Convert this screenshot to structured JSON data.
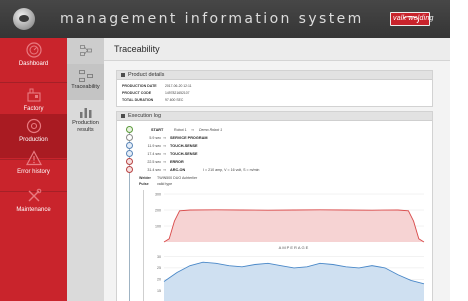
{
  "header": {
    "title": "management information system",
    "brand": "valk welding"
  },
  "sidebar": {
    "items": [
      {
        "label": "Dashboard",
        "icon": "dashboard-icon"
      },
      {
        "label": "Factory",
        "icon": "factory-icon"
      },
      {
        "label": "Production",
        "icon": "production-icon",
        "active": true
      },
      {
        "label": "Error history",
        "icon": "warning-icon"
      },
      {
        "label": "Maintenance",
        "icon": "tools-icon"
      }
    ]
  },
  "subnav": {
    "items": [
      {
        "label": "Traceability",
        "icon": "traceability-icon",
        "active": true
      },
      {
        "label": "Production results",
        "icon": "bar-chart-icon"
      }
    ]
  },
  "page": {
    "title": "Traceability"
  },
  "product_details": {
    "title": "Product details",
    "rows": [
      {
        "label": "PRODUCTION DATE",
        "value": "2017-06-20 12:11"
      },
      {
        "label": "PRODUCT CODE",
        "value": "1497821652107"
      },
      {
        "label": "TOTAL DURATION",
        "value": "97.600 SEC"
      }
    ]
  },
  "execution_log": {
    "title": "Execution log",
    "start": {
      "label": "START",
      "robot": "Robot 1",
      "arrow": "⇒",
      "description": "Demo Robot 1"
    },
    "events": [
      {
        "time": "5.9 sec",
        "arrow": "⇒",
        "event": "SERVICE PROGRAM",
        "detail": ""
      },
      {
        "time": "11.9 sec",
        "arrow": "⇒",
        "event": "TOUCH-SENSE",
        "detail": ""
      },
      {
        "time": "17.4 sec",
        "arrow": "⇒",
        "event": "TOUCH-SENSE",
        "detail": ""
      },
      {
        "time": "22.5 sec",
        "arrow": "⇒",
        "event": "ERROR",
        "detail": ""
      },
      {
        "time": "31.4 sec",
        "arrow": "⇒",
        "event": "ARC-ON",
        "detail": "I = 210 amp,   V = 16 volt,   S = m/min"
      }
    ],
    "welder_label": "Welder",
    "welder_value": "TWIN500 DUO Achterlier",
    "pulse_label": "Pulse",
    "pulse_value": "valid type"
  },
  "chart_data": [
    {
      "type": "line",
      "title": "",
      "xlabel": "",
      "ylabel": "",
      "ylim": [
        0,
        300
      ],
      "yticks": [
        100,
        200,
        300
      ],
      "color": "#d94b4b",
      "fill": "#f6d3d3",
      "x": [
        0,
        2,
        4,
        6,
        10,
        20,
        30,
        40,
        50,
        60,
        70,
        80,
        90,
        94,
        96,
        98,
        100
      ],
      "values": [
        0,
        20,
        130,
        195,
        200,
        201,
        200,
        199,
        200,
        201,
        200,
        199,
        200,
        195,
        130,
        20,
        0
      ]
    },
    {
      "type": "line",
      "title": "AMPERAGE",
      "xlabel": "",
      "ylabel": "",
      "ylim": [
        10,
        32
      ],
      "yticks": [
        15,
        20,
        25,
        30
      ],
      "color": "#4a88c8",
      "fill": "#cfe0f1",
      "x": [
        0,
        5,
        10,
        15,
        20,
        25,
        30,
        35,
        40,
        45,
        50,
        55,
        60,
        65,
        70,
        75,
        80,
        85,
        90,
        95,
        100
      ],
      "values": [
        19,
        23,
        26,
        27.5,
        27,
        26,
        25.5,
        26.5,
        27,
        26,
        25,
        25.5,
        27,
        26.5,
        25.5,
        25,
        26,
        25,
        22,
        19.5,
        18
      ]
    }
  ],
  "colors": {
    "sidebar": "#c9242c",
    "sidebar_active": "#a91b22",
    "header": "#3d3d3d",
    "red_series": "#d94b4b",
    "blue_series": "#4a88c8"
  }
}
